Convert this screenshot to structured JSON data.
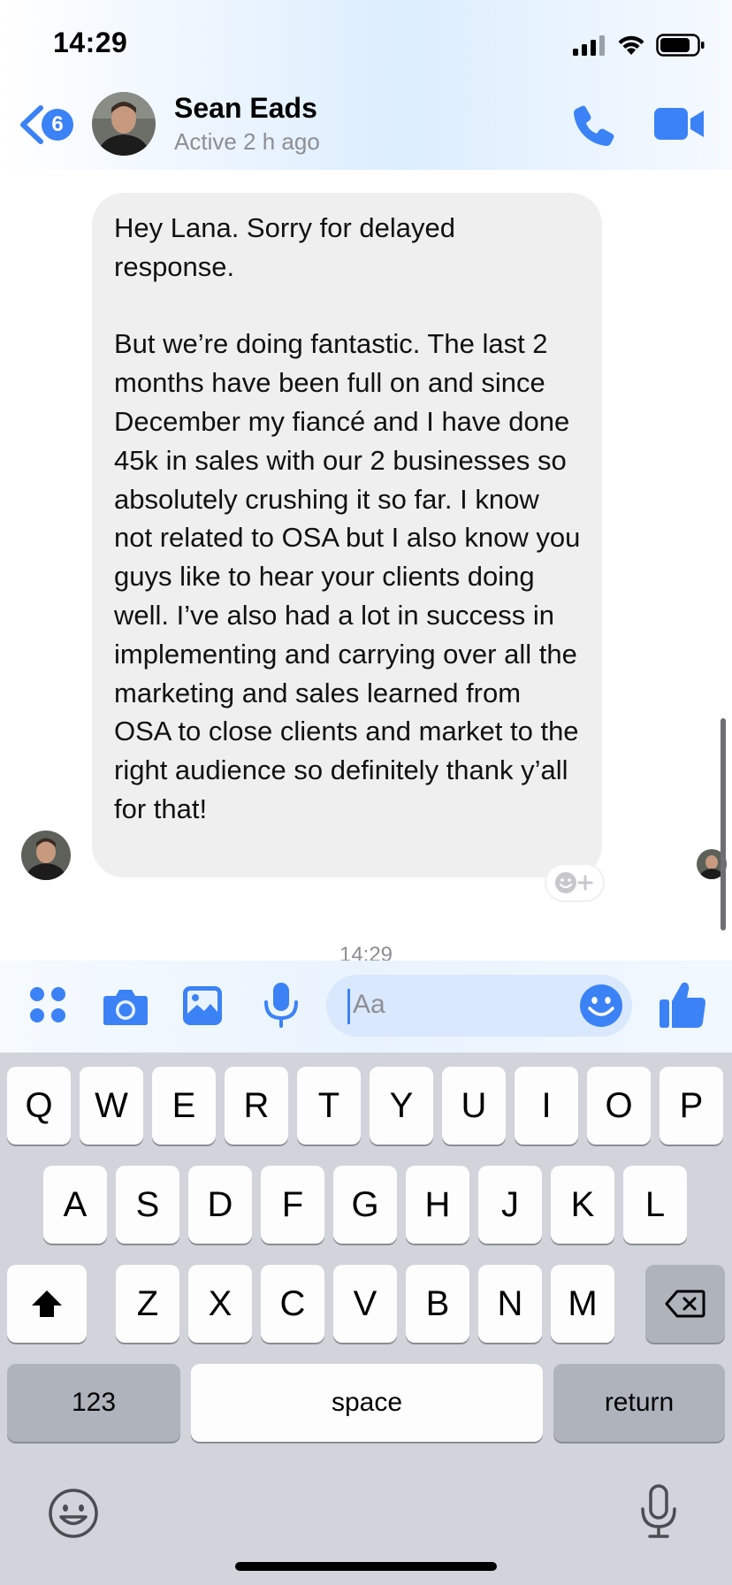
{
  "status_bar": {
    "time": "14:29"
  },
  "header": {
    "back_badge": "6",
    "contact_name": "Sean Eads",
    "contact_status": "Active 2 h ago"
  },
  "message": {
    "text": "Hey Lana. Sorry for delayed response.\n\nBut we’re doing fantastic. The last 2 months have been full on and since December my fiancé and I have done 45k in sales with our 2 businesses so  absolutely crushing it so far. I know not related to OSA but I also know you guys like to hear your clients doing well. I’ve also had a lot in success in implementing and carrying over all the marketing and sales learned from OSA to close clients and market to the right audience so definitely thank y’all for that!",
    "timestamp": "14:29"
  },
  "composer": {
    "placeholder": "Aa"
  },
  "keyboard": {
    "row1": [
      "Q",
      "W",
      "E",
      "R",
      "T",
      "Y",
      "U",
      "I",
      "O",
      "P"
    ],
    "row2": [
      "A",
      "S",
      "D",
      "F",
      "G",
      "H",
      "J",
      "K",
      "L"
    ],
    "row3": [
      "Z",
      "X",
      "C",
      "V",
      "B",
      "N",
      "M"
    ],
    "numbers_label": "123",
    "space_label": "space",
    "return_label": "return"
  },
  "colors": {
    "accent": "#3b82f6",
    "bubble": "#efefef",
    "keyboard_bg": "#d1d4da"
  },
  "icons": [
    "back-chevron-icon",
    "phone-icon",
    "video-camera-icon",
    "apps-grid-icon",
    "camera-icon",
    "photo-icon",
    "microphone-icon",
    "emoji-icon",
    "thumbs-up-icon",
    "shift-icon",
    "backspace-icon",
    "keyboard-emoji-icon",
    "dictation-icon"
  ]
}
